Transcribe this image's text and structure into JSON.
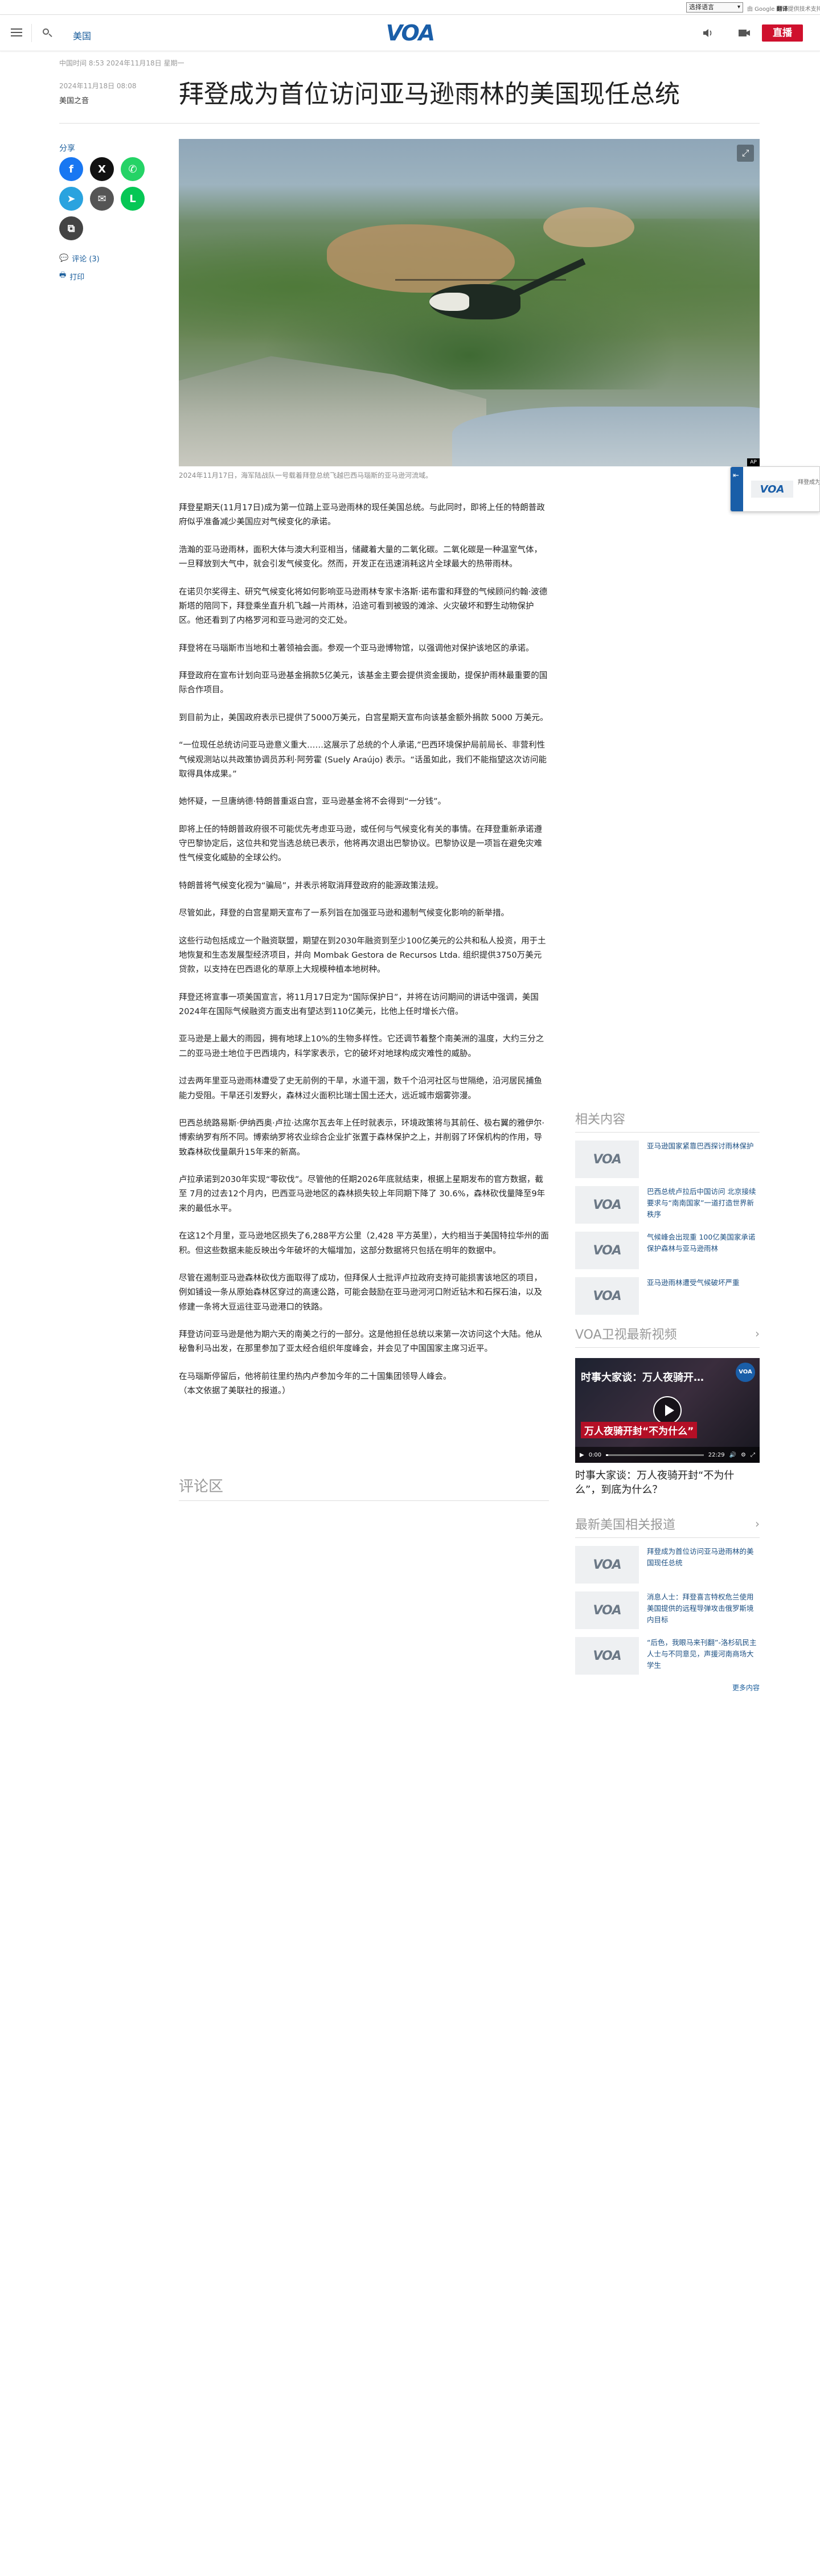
{
  "translate": {
    "select_label": "选择语言",
    "powered_prefix": "由 Google",
    "powered_brand": "翻译",
    "powered_suffix": "提供技术支持"
  },
  "header": {
    "section_link": "美国",
    "logo_text": "VOA",
    "live_label": "直播"
  },
  "article": {
    "meta_line": "中国时间 8:53 2024年11月18日 星期一",
    "pub_date": "2024年11月18日 08:08",
    "byline": "美国之音",
    "title": "拜登成为首位访问亚马逊雨林的美国现任总统",
    "share_label": "分享",
    "comments_link": "评论 (3)",
    "print_link": "打印",
    "image_caption": "2024年11月17日，海军陆战队一号载着拜登总统飞越巴西马瑙斯的亚马逊河流域。",
    "paragraphs": [
      "拜登星期天(11月17日)成为第一位踏上亚马逊雨林的现任美国总统。与此同时，即将上任的特朗普政府似乎准备减少美国应对气候变化的承诺。",
      "浩瀚的亚马逊雨林，面积大体与澳大利亚相当，储藏着大量的二氧化碳。二氧化碳是一种温室气体，一旦释放到大气中，就会引发气候变化。然而，开发正在迅速消耗这片全球最大的热带雨林。",
      "在诺贝尔奖得主、研究气候变化将如何影响亚马逊雨林专家卡洛斯·诺布雷和拜登的气候顾问约翰·波德斯塔的陪同下，拜登乘坐直升机飞越一片雨林，沿途可看到被毁的滩涂、火灾破坏和野生动物保护区。他还看到了内格罗河和亚马逊河的交汇处。",
      "拜登将在马瑙斯市当地和土著领袖会面。参观一个亚马逊博物馆，以强调他对保护该地区的承诺。",
      "拜登政府在宣布计划向亚马逊基金捐款5亿美元，该基金主要会提供资金援助，提保护雨林最重要的国际合作项目。",
      "到目前为止，美国政府表示已提供了5000万美元，白宫星期天宣布向该基金额外捐款 5000 万美元。",
      "“一位现任总统访问亚马逊意义重大……这展示了总统的个人承诺,”巴西环境保护局前局长、非营利性气候观测站以共政策协调员苏利·阿劳霍 (Suely Araújo) 表示。“话虽如此，我们不能指望这次访问能取得具体成果。”",
      "她怀疑，一旦唐纳德·特朗普重返白宫，亚马逊基金将不会得到“一分钱”。",
      "即将上任的特朗普政府很不可能优先考虑亚马逊，或任何与气候变化有关的事情。在拜登重新承诺遵守巴黎协定后，这位共和党当选总统已表示，他将再次退出巴黎协议。巴黎协议是一项旨在避免灾难性气候变化威胁的全球公约。",
      "特朗普将气候变化视为“骗局”，并表示将取消拜登政府的能源政策法规。",
      "尽管如此，拜登的白宫星期天宣布了一系列旨在加强亚马逊和遏制气候变化影响的新举措。",
      "这些行动包括成立一个融资联盟，期望在到2030年融资到至少100亿美元的公共和私人投资，用于土地恢复和生态发展型经济项目，并向 Mombak Gestora de Recursos Ltda. 组织提供3750万美元贷款，以支持在巴西退化的草原上大规模种植本地树种。",
      "拜登还将宣事一项美国宣言，将11月17日定为“国际保护日”，并将在访问期间的讲话中强调，美国2024年在国际气候融资方面支出有望达到110亿美元，比他上任时增长六倍。",
      "亚马逊是上最大的雨园，拥有地球上10%的生物多样性。它还调节着整个南美洲的温度，大约三分之二的亚马逊土地位于巴西境内，科学家表示，它的破坏对地球构成灾难性的威胁。",
      "过去两年里亚马逊雨林遭受了史无前例的干旱，水道干涸，数千个沿河社区与世隔绝，沿河居民捕鱼能力受阻。干旱还引发野火，森林过火面积比瑞士国土还大，远近城市烟雾弥漫。",
      "巴西总统路易斯·伊纳西奥·卢拉·达席尔瓦去年上任时就表示，环境政策将与其前任、极右翼的雅伊尔·博索纳罗有所不同。博索纳罗将农业综合企业扩张置于森林保护之上，并削弱了环保机构的作用，导致森林砍伐量飙升15年来的新高。",
      "卢拉承诺到2030年实现“零砍伐”。尽管他的任期2026年底就结束，根据上星期发布的官方数据，截至 7月的过去12个月内，巴西亚马逊地区的森林损失较上年同期下降了 30.6%，森林砍伐量降至9年来的最低水平。",
      "在这12个月里，亚马逊地区损失了6,288平方公里（2,428 平方英里），大约相当于美国特拉华州的面积。但这些数据未能反映出今年破坏的大幅增加，这部分数据将只包括在明年的数据中。",
      "尽管在遏制亚马逊森林砍伐方面取得了成功，但拜保人士批评卢拉政府支持可能损害该地区的项目，例如铺设一条从原始森林区穿过的高速公路，可能会鼓励在亚马逊河河口附近钻木和石探石油，以及修建一条将大豆运往亚马逊港口的铁路。",
      "拜登访问亚马逊是他为期六天的南美之行的一部分。这是他担任总统以来第一次访问这个大陆。他从秘鲁利马出发，在那里参加了亚太经合组织年度峰会，并会见了中国国家主席习近平。",
      "在马瑙斯停留后，他将前往里约热内卢参加今年的二十国集团领导人峰会。\n（本文依据了美联社的报道。）"
    ],
    "comments_section_title": "评论区"
  },
  "aside": {
    "related_title": "相关内容",
    "related": [
      "亚马逊国家紧靠巴西探讨雨林保护",
      "巴西总统卢拉后中国访问 北京接续要求与“南南国家”一道打造世界新秩序",
      "气候峰会出现重 100亿美国家承诺保护森林与亚马逊雨林",
      "亚马逊雨林遭受气候破坏严重"
    ],
    "video_title_header": "VOA卫视最新视频",
    "video_overlay_top": "时事大家谈：万人夜骑开…",
    "video_overlay_bottom": "万人夜骑开封“不为什么”",
    "video_time_current": "0:00",
    "video_time_total": "22:29",
    "video_progress": 0.02,
    "video_caption": "时事大家谈：万人夜骑开封“不为什么”，到底为什么？",
    "latest_title": "最新美国相关报道",
    "latest": [
      "拜登成为首位访问亚马逊雨林的美国现任总统",
      "消息人士：拜登喜言特权危兰使用美国提供的远程导弹攻击俄罗斯境内目标",
      "“后色，我眼马来刊翻”-洛杉矶民主人士与不同意见，声援河南商场大学生"
    ],
    "more_link": "更多内容"
  },
  "float_widget": {
    "logo_text": "VOA",
    "text": "拜登成为首位访问亚马逊雨林"
  },
  "colors": {
    "brand_blue": "#1a5ea8",
    "live_red": "#cf102d",
    "link_blue": "#1b5e9c"
  }
}
